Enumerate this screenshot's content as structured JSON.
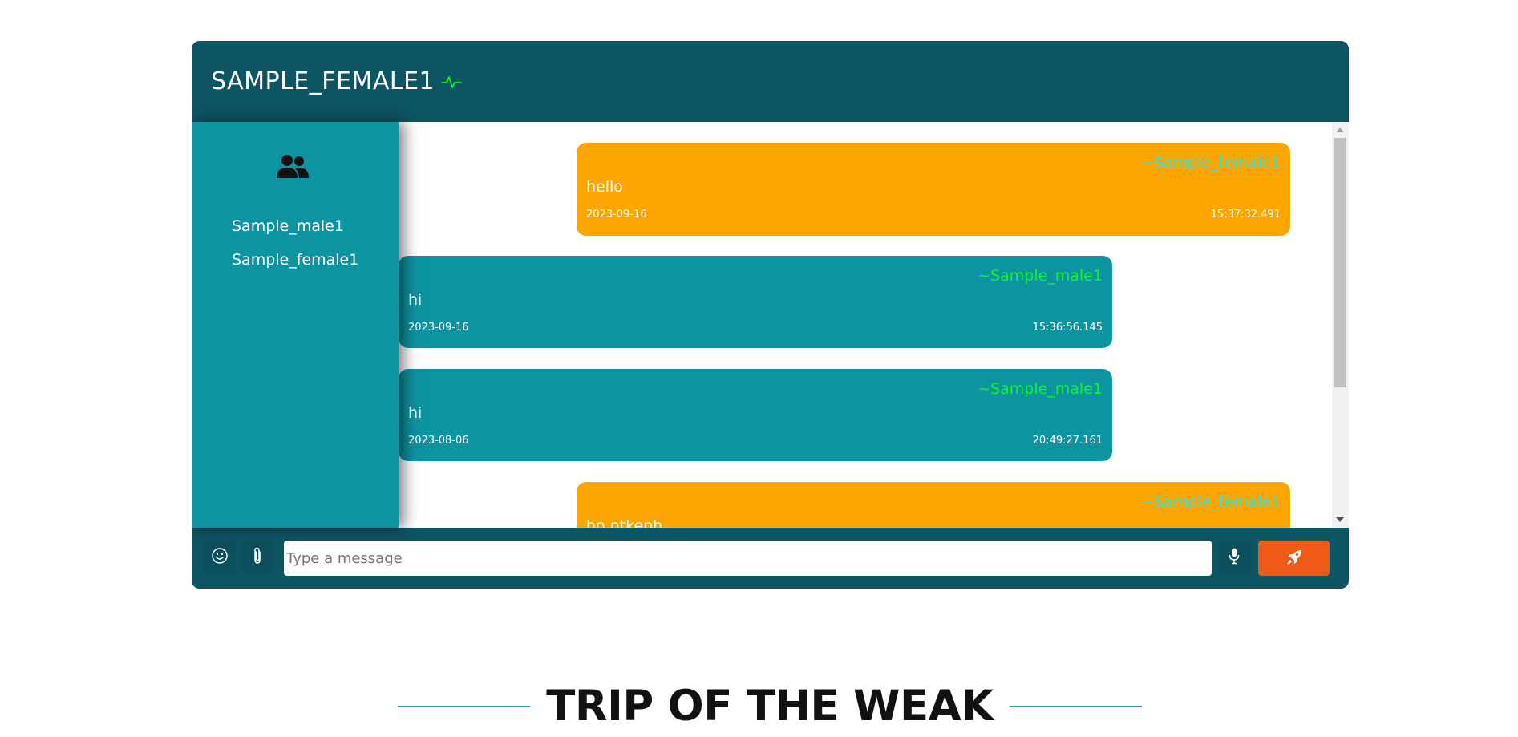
{
  "header": {
    "title": "SAMPLE_FEMALE1",
    "status_icon": "activity-pulse-icon",
    "status_color": "#0df52c"
  },
  "sidebar": {
    "icon": "users-icon",
    "users": [
      {
        "name": "Sample_male1"
      },
      {
        "name": "Sample_female1"
      }
    ]
  },
  "messages": [
    {
      "direction": "outgoing",
      "sender": "~Sample_female1",
      "text": "hello",
      "date": "2023-09-16",
      "time": "15:37:32.491"
    },
    {
      "direction": "incoming",
      "sender": "~Sample_male1",
      "text": "hi",
      "date": "2023-09-16",
      "time": "15:36:56.145"
    },
    {
      "direction": "incoming",
      "sender": "~Sample_male1",
      "text": "hi",
      "date": "2023-08-06",
      "time": "20:49:27.161"
    },
    {
      "direction": "outgoing",
      "sender": "~Sample_female1",
      "text": "ho ntkenh",
      "date": "",
      "time": ""
    }
  ],
  "composer": {
    "emoji_icon": "smiley-icon",
    "attach_icon": "paperclip-icon",
    "placeholder": "Type a message",
    "value": "",
    "mic_icon": "microphone-icon",
    "send_icon": "rocket-icon"
  },
  "section": {
    "heading": "TRIP OF THE WEAK"
  },
  "colors": {
    "header_bg": "#0e5563",
    "sidebar_bg": "#0e93a0",
    "outgoing_bubble": "#ffa500",
    "incoming_bubble": "#0e93a0",
    "send_button": "#f05a17"
  }
}
